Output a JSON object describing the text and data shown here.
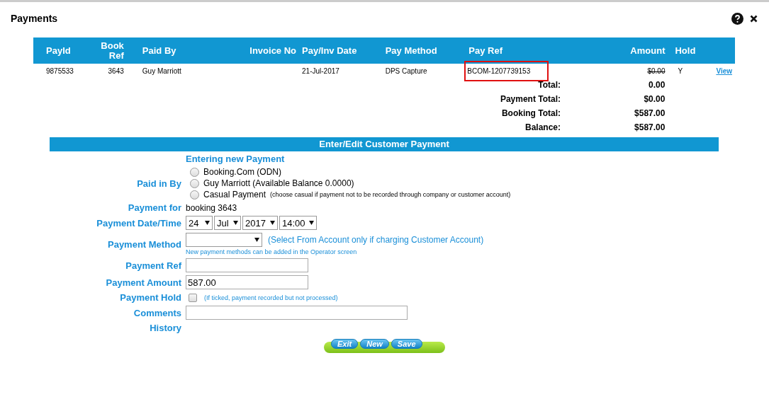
{
  "window": {
    "title": "Payments"
  },
  "table": {
    "columns": [
      "PayId",
      "Book Ref",
      "Paid By",
      "Invoice No",
      "Pay/Inv Date",
      "Pay Method",
      "Pay Ref",
      "Amount",
      "Hold"
    ],
    "rows": [
      {
        "pay_id": "9875533",
        "book_ref": "3643",
        "paid_by": "Guy Marriott",
        "pay_inv_date": "21-Jul-2017",
        "pay_method": "DPS Capture",
        "pay_ref": "BCOM-1207739153",
        "pay_ref_highlighted": true,
        "amount": "$0.00",
        "amount_struck": true,
        "hold": "Y",
        "link": "View"
      }
    ],
    "totals": [
      {
        "label": "Total:",
        "value": "0.00"
      },
      {
        "label": "Payment Total:",
        "value": "$0.00"
      },
      {
        "label": "Booking Total:",
        "value": "$587.00"
      },
      {
        "label": "Balance:",
        "value": "$587.00"
      }
    ]
  },
  "form": {
    "title": "Enter/Edit Customer Payment",
    "subtitle": "Entering new Payment",
    "paid_in_by": {
      "label": "Paid in By",
      "options": [
        {
          "label": "Booking.Com (ODN)",
          "selected": false
        },
        {
          "label": "Guy Marriott (Available Balance 0.0000)",
          "selected": false
        },
        {
          "label": "Casual Payment",
          "note": "(choose casual if payment not to be recorded through company or customer account)",
          "selected": false
        }
      ]
    },
    "payment_for": {
      "label": "Payment for",
      "value": "booking 3643"
    },
    "date_time": {
      "label": "Payment Date/Time",
      "selects": [
        "24",
        "Jul",
        "2017",
        "14:00"
      ]
    },
    "method": {
      "label": "Payment Method",
      "hint": "(Select From Account only if charging Customer Account)",
      "note": "New payment methods can be added in the Operator screen"
    },
    "ref": {
      "label": "Payment Ref"
    },
    "amount": {
      "label": "Payment Amount",
      "value": "587.00"
    },
    "hold": {
      "label": "Payment Hold",
      "checked": false,
      "hint": "(If ticked, payment recorded but not processed)"
    },
    "comments": {
      "label": "Comments"
    },
    "history": {
      "label": "History"
    },
    "buttons": [
      "Exit",
      "New",
      "Save"
    ]
  }
}
